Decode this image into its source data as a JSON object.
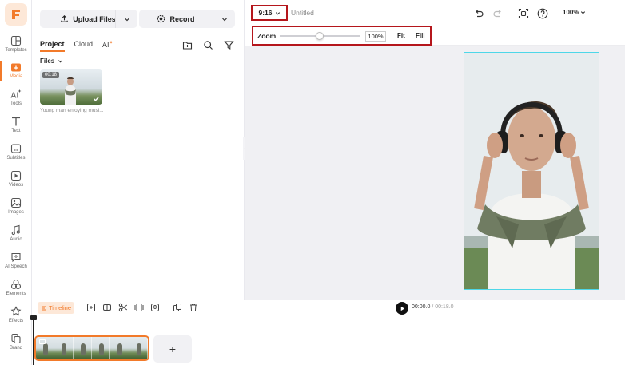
{
  "rail": {
    "items": [
      {
        "label": "Templates",
        "icon": "templates-icon"
      },
      {
        "label": "Media",
        "icon": "media-icon",
        "active": true
      },
      {
        "label": "Tools",
        "icon": "ai-tools-icon"
      },
      {
        "label": "Text",
        "icon": "text-icon"
      },
      {
        "label": "Subtitles",
        "icon": "subtitles-icon"
      },
      {
        "label": "Videos",
        "icon": "videos-icon"
      },
      {
        "label": "Images",
        "icon": "images-icon"
      },
      {
        "label": "Audio",
        "icon": "audio-icon"
      },
      {
        "label": "AI Speech",
        "icon": "ai-speech-icon"
      },
      {
        "label": "Elements",
        "icon": "elements-icon"
      },
      {
        "label": "Effects",
        "icon": "effects-icon"
      },
      {
        "label": "Brand",
        "icon": "brand-icon"
      }
    ]
  },
  "panel": {
    "upload_label": "Upload Files",
    "record_label": "Record",
    "tabs": [
      "Project",
      "Cloud",
      "AI"
    ],
    "files_label": "Files",
    "media_item": {
      "duration": "00:18",
      "caption": "Young man enjoying musi..."
    }
  },
  "topbar": {
    "ratio": "9:16",
    "title": "Untitled",
    "zoom_menu": "100%"
  },
  "zoom": {
    "label": "Zoom",
    "value": "100%",
    "fit_label": "Fit",
    "fill_label": "Fill"
  },
  "timeline": {
    "button_label": "Timeline",
    "current_time": "00:00.0",
    "total_time": "/ 00:18.0",
    "add_label": "+"
  },
  "colors": {
    "accent": "#f27a2a",
    "highlight": "#b5161c",
    "frame": "#4ed7e8"
  }
}
